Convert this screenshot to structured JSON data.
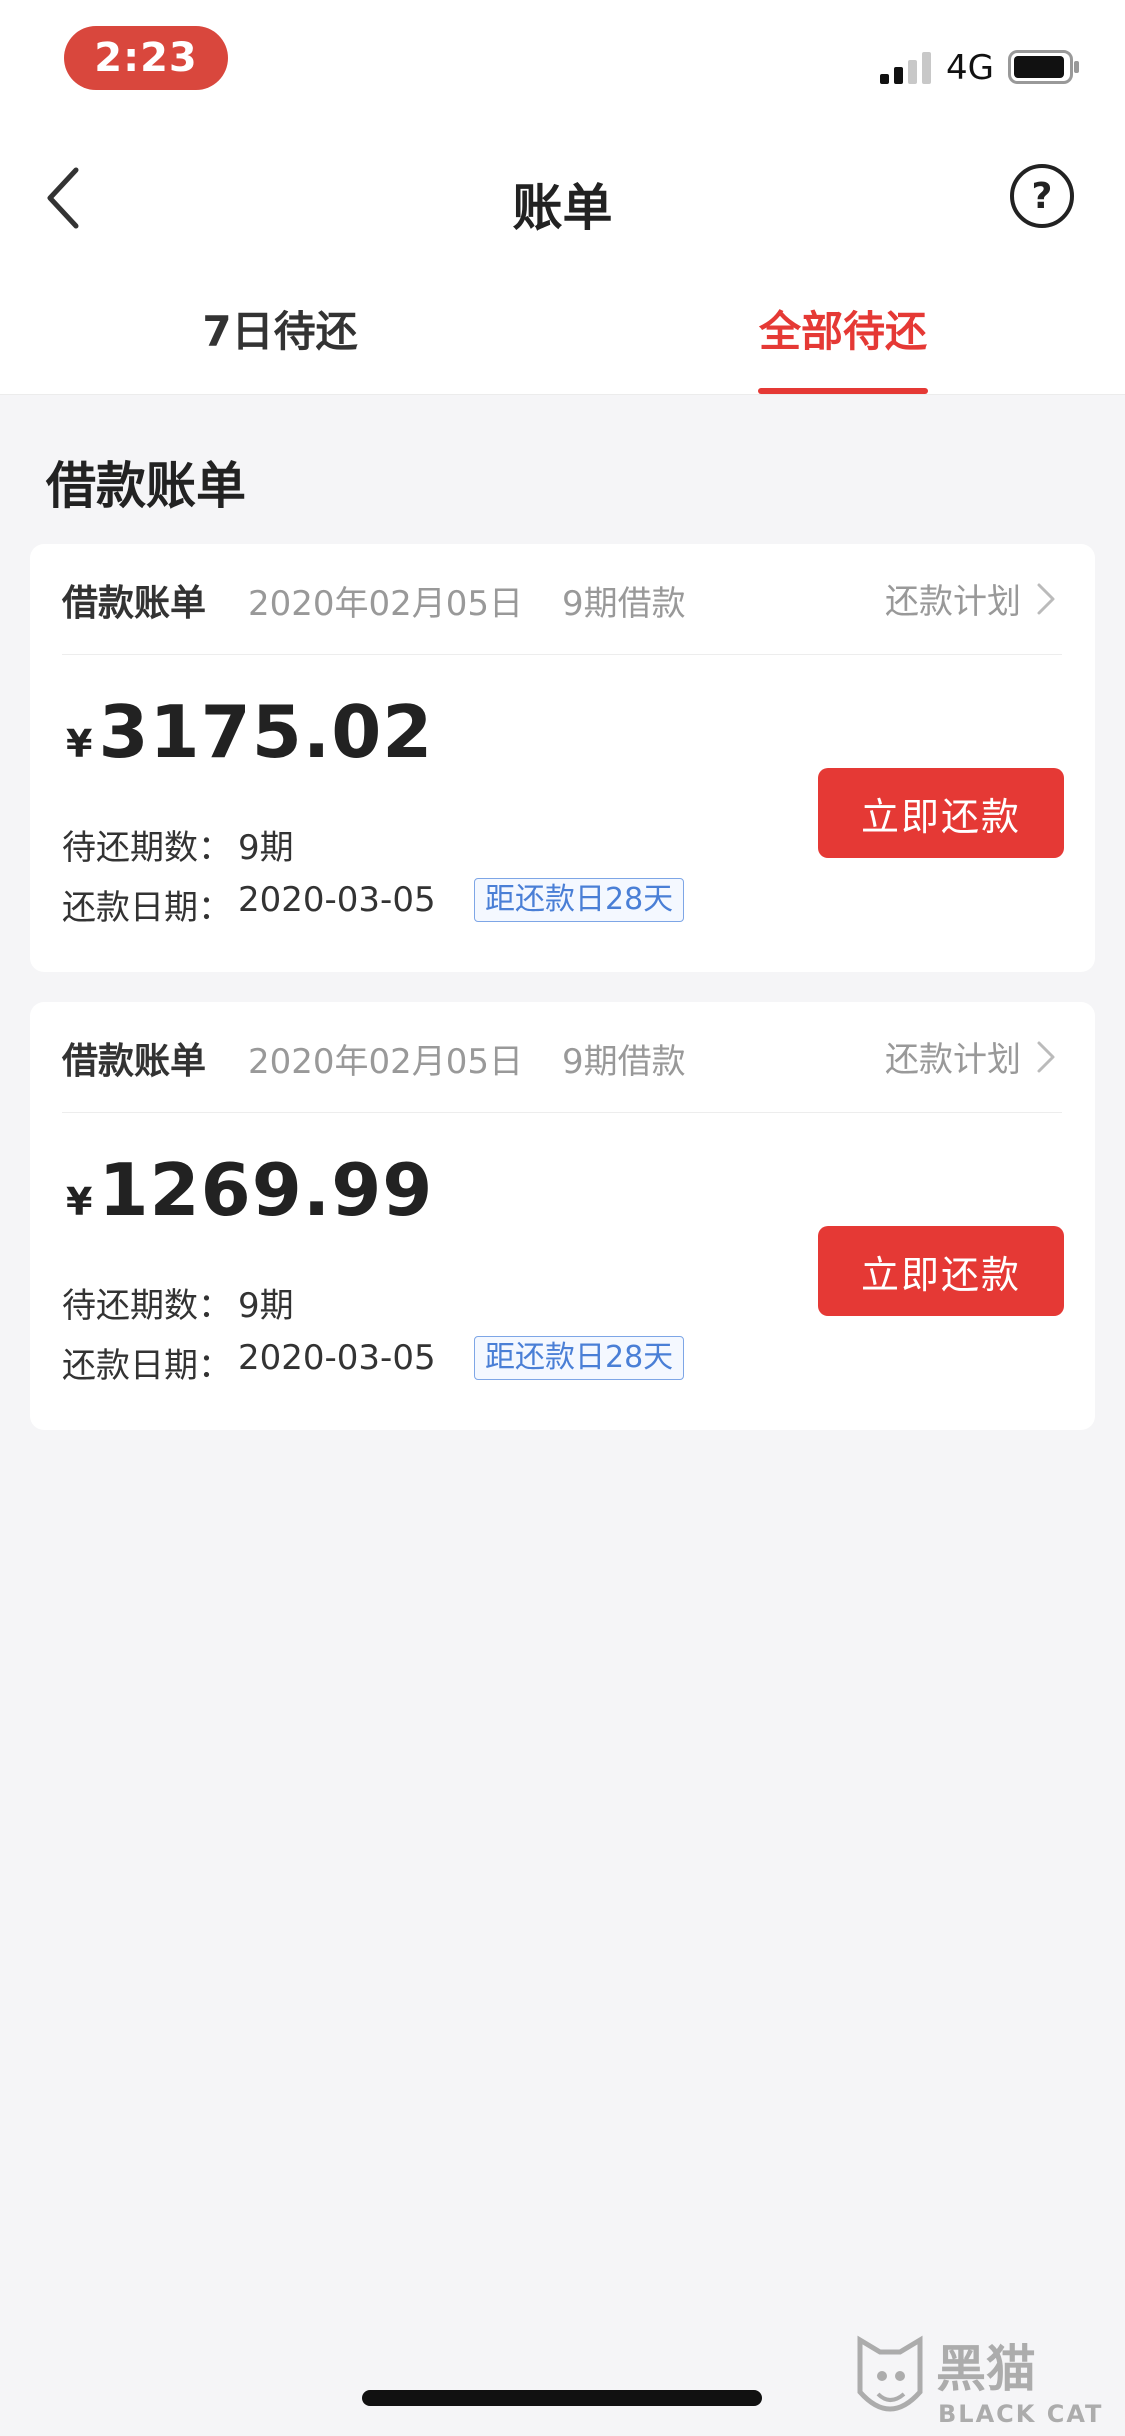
{
  "status_bar": {
    "time": "2:23",
    "network": "4G"
  },
  "nav": {
    "title": "账单",
    "help": "?"
  },
  "tabs": [
    {
      "label": "7日待还",
      "active": false
    },
    {
      "label": "全部待还",
      "active": true
    }
  ],
  "section_title": "借款账单",
  "bills": [
    {
      "label": "借款账单",
      "date": "2020年02月05日",
      "term": "9期借款",
      "plan_link": "还款计划",
      "currency": "¥",
      "amount": "3175.02",
      "pending_label": "待还期数：",
      "pending_value": "9期",
      "due_label": "还款日期：",
      "due_value": "2020-03-05",
      "countdown": "距还款日28天",
      "pay_label": "立即还款"
    },
    {
      "label": "借款账单",
      "date": "2020年02月05日",
      "term": "9期借款",
      "plan_link": "还款计划",
      "currency": "¥",
      "amount": "1269.99",
      "pending_label": "待还期数：",
      "pending_value": "9期",
      "due_label": "还款日期：",
      "due_value": "2020-03-05",
      "countdown": "距还款日28天",
      "pay_label": "立即还款"
    }
  ],
  "colors": {
    "accent": "#e53935",
    "badge_blue": "#4a7fd6",
    "background": "#f5f5f7"
  },
  "watermark": {
    "logo_text": "黑猫",
    "logo_subtext": "BLACK CAT"
  }
}
